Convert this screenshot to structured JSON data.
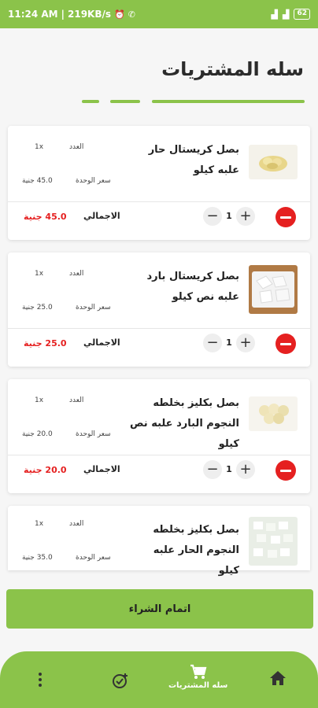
{
  "status_bar": {
    "time": "11:24 AM",
    "net_speed": "219KB/s",
    "battery": "62"
  },
  "page": {
    "title": "سله المشتريات"
  },
  "labels": {
    "qty": "العدد",
    "unit_price": "سعر الوحدة",
    "total": "الاجمالي"
  },
  "cart_items": [
    {
      "name": "بصل كريستال حار علبه كيلو",
      "qty_text": "1x",
      "unit_price": "45.0 جنية",
      "quantity": "1",
      "total_price": "45.0 جنية"
    },
    {
      "name": "بصل كريستال بارد علبه نص كيلو",
      "qty_text": "1x",
      "unit_price": "25.0 جنية",
      "quantity": "1",
      "total_price": "25.0 جنية"
    },
    {
      "name": "بصل بكليز بخلطه النجوم البارد علبه نص كيلو",
      "qty_text": "1x",
      "unit_price": "20.0 جنية",
      "quantity": "1",
      "total_price": "20.0 جنية"
    },
    {
      "name": "بصل بكليز بخلطه النجوم الحار علبه كيلو",
      "qty_text": "1x",
      "unit_price": "35.0 جنية"
    }
  ],
  "checkout": {
    "label": "اتمام الشراء"
  },
  "bottom_nav": {
    "cart_label": "سله المشتريات",
    "icons": [
      "home-icon",
      "cart-icon",
      "add-task-icon",
      "more-icon"
    ]
  },
  "colors": {
    "brand": "#8bc34a",
    "danger": "#e52020"
  }
}
